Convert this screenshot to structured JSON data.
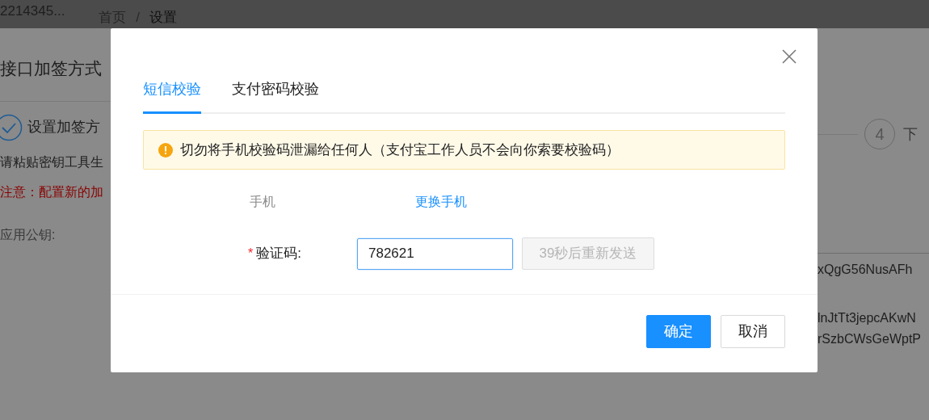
{
  "header": {
    "account": "2214345...",
    "breadcrumb": [
      {
        "label": "首页",
        "current": false
      },
      {
        "label": "设置",
        "current": true
      }
    ],
    "separator": "/"
  },
  "page": {
    "title": "接口加签方式",
    "steps": [
      {
        "label": "设置加签方",
        "done": true
      },
      {
        "label": "下",
        "number": "4",
        "done": false
      }
    ],
    "notes": [
      {
        "text": "请粘贴密钥工具生",
        "kind": "plain"
      },
      {
        "text": "注意：配置新的加",
        "kind": "warning"
      }
    ],
    "field_label": "应用公钥:",
    "key_lines": [
      "xQgG56NusAFh",
      "lnJtTt3jepcAKwN",
      "rSzbCWsGeWptP"
    ]
  },
  "dialog": {
    "tabs": [
      {
        "label": "短信校验",
        "selected": true
      },
      {
        "label": "支付密码校验",
        "selected": false
      }
    ],
    "alert": "切勿将手机校验码泄漏给任何人（支付宝工作人员不会向你索要校验码）",
    "phone_label": "手机",
    "change_phone_link": "更换手机",
    "code_label": "验证码:",
    "required_mark": "*",
    "code_value": "782621",
    "resend": {
      "label": "39秒后重新发送",
      "disabled": true
    },
    "buttons": [
      {
        "label": "确定",
        "kind": "primary"
      },
      {
        "label": "取消",
        "kind": "default"
      }
    ]
  }
}
